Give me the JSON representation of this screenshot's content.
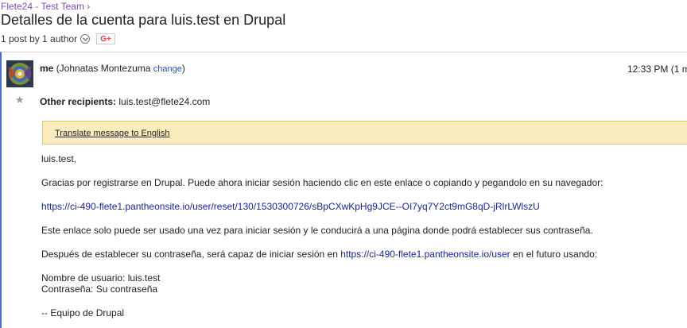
{
  "group": {
    "breadcrumb": "Flete24 - Test Team",
    "breadcrumb_sep": "›"
  },
  "thread": {
    "title": "Detalles de la cuenta para luis.test en Drupal",
    "meta": "1 post by 1 author",
    "gplus": "G+"
  },
  "message": {
    "sender_name": "me",
    "sender_detail": "(Johnatas Montezuma",
    "change_label": "change",
    "sender_close": ")",
    "time": "12:33 PM (1 m",
    "other_recipients_label": "Other recipients:",
    "other_recipients_value": "luis.test@flete24.com",
    "translate_label": "Translate message to English",
    "body": {
      "greeting": "luis.test,",
      "line1": "Gracias por registrarse en Drupal. Puede ahora iniciar sesión haciendo clic en este enlace o copiando y pegandolo en su navegador:",
      "reset_link": "https://ci-490-flete1.pantheonsite.io/user/reset/130/1530300726/sBpCXwKpHg9JCE--OI7yq7Y2ct9mG8qD-jRlrLWlszU",
      "line2": "Este enlace solo puede ser usado una vez para iniciar sesión y le conducirá a una página donde podrá establecer sus contraseña.",
      "line3_before": "Después de establecer su contraseña, será capaz de iniciar sesión en ",
      "login_link": "https://ci-490-flete1.pantheonsite.io/user",
      "line3_after": " en el futuro usando:",
      "username_line": "Nombre de usuario: luis.test",
      "password_line": "Contraseña: Su contraseña",
      "signature": "--  Equipo de Drupal"
    }
  },
  "colors": {
    "accent_border": "#4d6bd3",
    "link": "#1a22a8",
    "translate_bg": "#f9edbe"
  },
  "icons": [
    "chevron-down-icon",
    "google-plus-icon",
    "star-icon",
    "avatar"
  ]
}
